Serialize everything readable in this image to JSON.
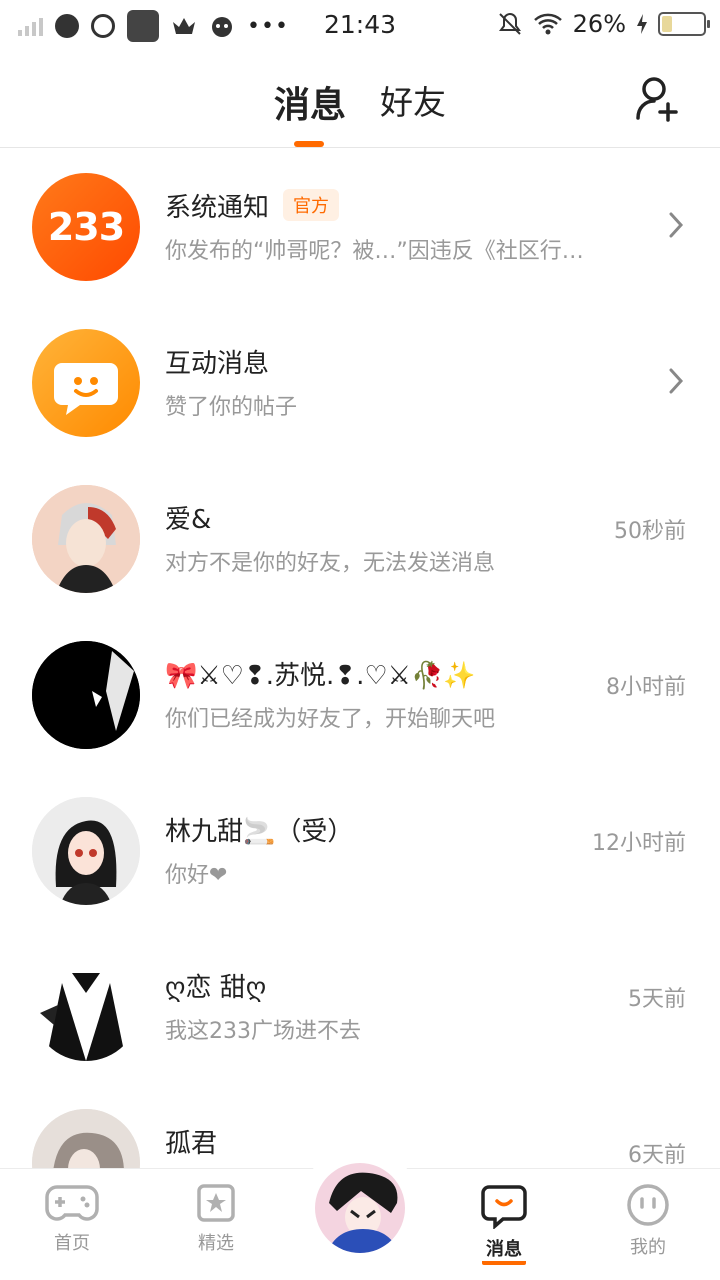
{
  "status_bar": {
    "time": "21:43",
    "battery": "26%",
    "battery_level": 0.26
  },
  "header": {
    "tabs": [
      "消息",
      "好友"
    ],
    "active_tab": "消息"
  },
  "messages": [
    {
      "name": "系统通知",
      "badge": "官方",
      "avatar_text": "233",
      "preview": "你发布的“帅哥呢？被…”因违反《社区行…",
      "time": ""
    },
    {
      "name": "互动消息",
      "preview": "赞了你的帖子",
      "time": ""
    },
    {
      "name": "爱&",
      "preview": "对方不是你的好友，无法发送消息",
      "time": "50秒前"
    },
    {
      "name": "🎀⚔♡❢.苏悦.❢.♡⚔🥀✨",
      "preview": "你们已经成为好友了，开始聊天吧",
      "time": "8小时前"
    },
    {
      "name": "林九甜🚬（受）",
      "preview": "你好❤",
      "time": "12小时前"
    },
    {
      "name": "ღ恋 甜ღ",
      "preview": "我这233广场进不去",
      "time": "5天前"
    },
    {
      "name": "孤君",
      "preview": "",
      "time": "6天前"
    }
  ],
  "bottom_nav": {
    "items": [
      "首页",
      "精选",
      "消息",
      "我的"
    ],
    "active": "消息"
  },
  "colors": {
    "accent": "#ff6a00",
    "muted": "#999999"
  }
}
